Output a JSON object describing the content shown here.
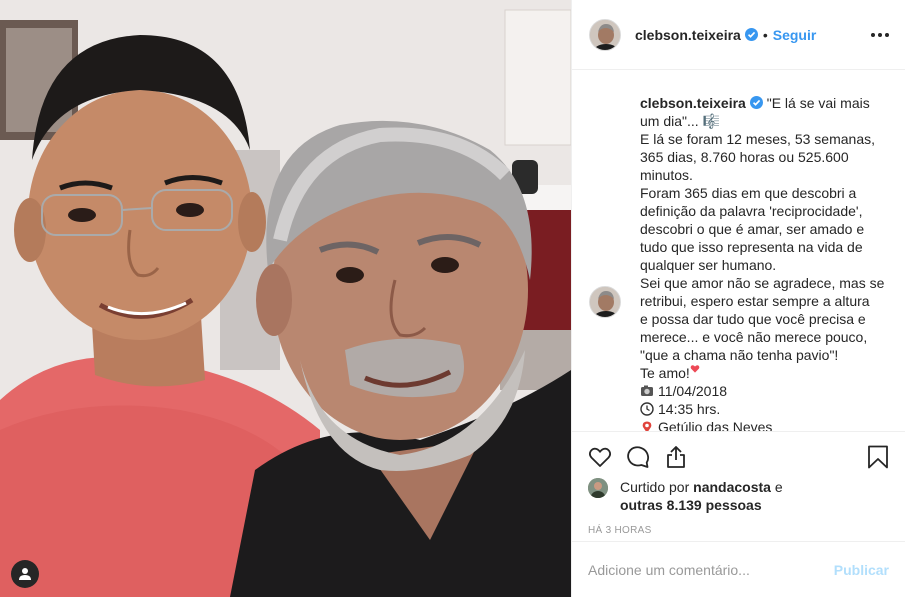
{
  "post": {
    "username": "clebson.teixeira",
    "follow_label": "Seguir",
    "separator": "•"
  },
  "caption": {
    "username": "clebson.teixeira",
    "line1": "\"E lá se vai mais",
    "line2": "um dia\"... 🎼",
    "line3": "E lá se foram 12 meses, 53 semanas,",
    "line4": "365 dias, 8.760 horas ou 525.600",
    "line5": "minutos.",
    "line6": "Foram 365 dias em que descobri a",
    "line7": "definição da palavra 'reciprocidade',",
    "line8": "descobri o que é amar, ser amado e",
    "line9": "tudo que isso representa na vida de",
    "line10": "qualquer ser humano.",
    "line11": "Sei que amor não se agradece, mas se",
    "line12": "retribui, espero estar sempre a altura",
    "line13": "e possa dar tudo que você precisa e",
    "line14": "merece... e você não merece pouco,",
    "line15": "\"que a chama não tenha pavio\"!",
    "line16": "Te amo!",
    "date": "11/04/2018",
    "time": "14:35 hrs.",
    "location": "Getúlio das Neves"
  },
  "likes": {
    "prefix": "Curtido por",
    "user": "nandacosta",
    "conj": "e",
    "others": "outras 8.139 pessoas"
  },
  "timestamp": "HÁ 3 HORAS",
  "comment_box": {
    "placeholder": "Adicione um comentário...",
    "publish_label": "Publicar"
  },
  "colors": {
    "link": "#3897f0",
    "publish_disabled": "#b2dffc",
    "verified": "#3897f0",
    "heart_emoji": "#ed4956"
  },
  "icons": [
    "verified-badge-icon",
    "more-options-icon",
    "heart-icon",
    "comment-icon",
    "share-icon",
    "bookmark-icon",
    "tag-person-icon",
    "camera-emoji-icon",
    "clock-emoji-icon",
    "pin-emoji-icon",
    "music-emoji-icon"
  ]
}
